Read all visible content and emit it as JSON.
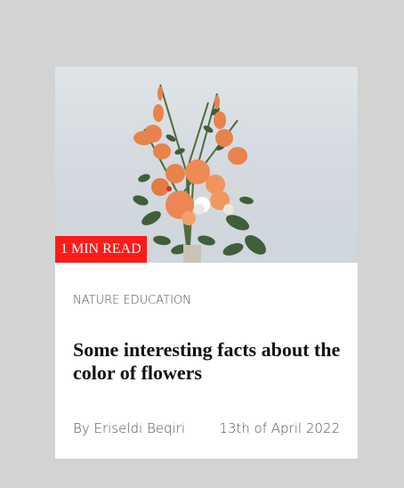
{
  "card": {
    "badge": "1 MIN READ",
    "category": "NATURE EDUCATION",
    "title": "Some interesting facts about the color of flowers",
    "author": "By Eriseldi Beqiri",
    "date": "13th of April 2022",
    "image_icon": "flower-bouquet-image"
  },
  "colors": {
    "page_background": "#d3d3d3",
    "card_background": "#ffffff",
    "badge_background": "#ff1a1a",
    "badge_text": "#ffffff",
    "title_text": "#111111",
    "meta_text": "#555555"
  }
}
